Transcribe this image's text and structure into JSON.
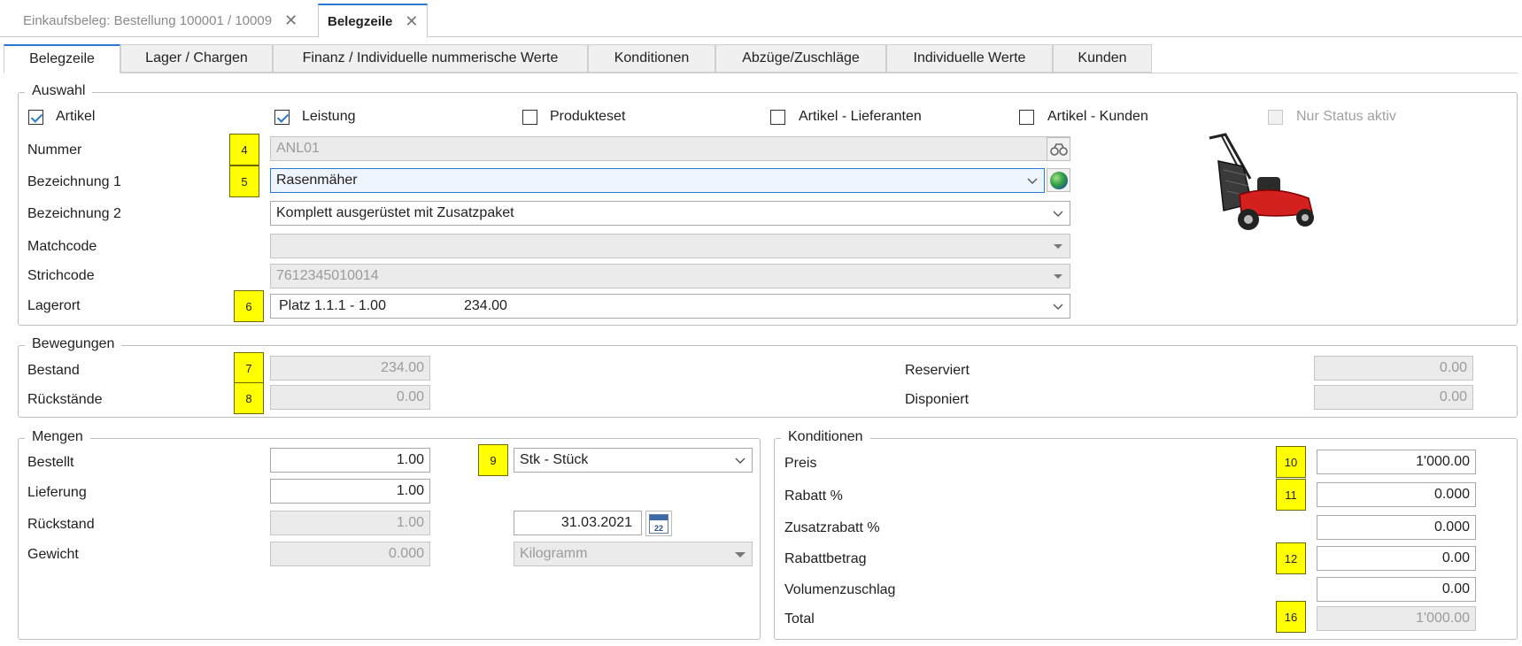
{
  "doc_tabs": [
    {
      "label": "Einkaufsbeleg: Bestellung 100001 / 10009"
    },
    {
      "label": "Belegzeile"
    }
  ],
  "close_glyph": "✕",
  "sub_tabs": [
    {
      "label": "Belegzeile"
    },
    {
      "label": "Lager / Chargen"
    },
    {
      "label": "Finanz / Individuelle nummerische Werte"
    },
    {
      "label": "Konditionen"
    },
    {
      "label": "Abzüge/Zuschläge"
    },
    {
      "label": "Individuelle Werte"
    },
    {
      "label": "Kunden"
    }
  ],
  "auswahl": {
    "title": "Auswahl",
    "checkboxes": [
      {
        "label": "Artikel",
        "checked": true
      },
      {
        "label": "Leistung",
        "checked": true
      },
      {
        "label": "Produkteset",
        "checked": false
      },
      {
        "label": "Artikel - Lieferanten",
        "checked": false
      },
      {
        "label": "Artikel - Kunden",
        "checked": false
      },
      {
        "label": "Nur Status aktiv",
        "checked": false,
        "disabled": true
      }
    ],
    "nummer_label": "Nummer",
    "nummer_badge": "4",
    "nummer_value": "ANL01",
    "bez1_label": "Bezeichnung 1",
    "bez1_badge": "5",
    "bez1_value": "Rasenmäher",
    "bez2_label": "Bezeichnung 2",
    "bez2_value": "Komplett ausgerüstet mit Zusatzpaket",
    "matchcode_label": "Matchcode",
    "matchcode_value": "",
    "strichcode_label": "Strichcode",
    "strichcode_value": "7612345010014",
    "lagerort_label": "Lagerort",
    "lagerort_badge": "6",
    "lagerort_place": "Platz 1.1.1 - 1.00",
    "lagerort_qty": "234.00",
    "image_icon": "lawnmower-image"
  },
  "bewegungen": {
    "title": "Bewegungen",
    "bestand_label": "Bestand",
    "bestand_badge": "7",
    "bestand_value": "234.00",
    "rueckstaende_label": "Rückstände",
    "rueckstaende_badge": "8",
    "rueckstaende_value": "0.00",
    "reserviert_label": "Reserviert",
    "reserviert_value": "0.00",
    "disponiert_label": "Disponiert",
    "disponiert_value": "0.00"
  },
  "mengen": {
    "title": "Mengen",
    "bestellt_label": "Bestellt",
    "bestellt_value": "1.00",
    "einheit_badge": "9",
    "einheit_value": "Stk - Stück",
    "lieferung_label": "Lieferung",
    "lieferung_value": "1.00",
    "rueckstand_label": "Rückstand",
    "rueckstand_value": "1.00",
    "datum_value": "31.03.2021",
    "calendar_day": "22",
    "gewicht_label": "Gewicht",
    "gewicht_value": "0.000",
    "gewicht_unit": "Kilogramm"
  },
  "konditionen": {
    "title": "Konditionen",
    "preis_label": "Preis",
    "preis_badge": "10",
    "preis_value": "1'000.00",
    "rabatt_label": "Rabatt %",
    "rabatt_badge": "11",
    "rabatt_value": "0.000",
    "zusatzrabatt_label": "Zusatzrabatt %",
    "zusatzrabatt_value": "0.000",
    "rabattbetrag_label": "Rabattbetrag",
    "rabattbetrag_badge": "12",
    "rabattbetrag_value": "0.00",
    "volumen_label": "Volumenzuschlag",
    "volumen_value": "0.00",
    "total_label": "Total",
    "total_badge": "16",
    "total_value": "1'000.00"
  },
  "colors": {
    "accent": "#2a78d2",
    "badge": "#ffff00",
    "disabled_bg": "#ebebeb"
  }
}
